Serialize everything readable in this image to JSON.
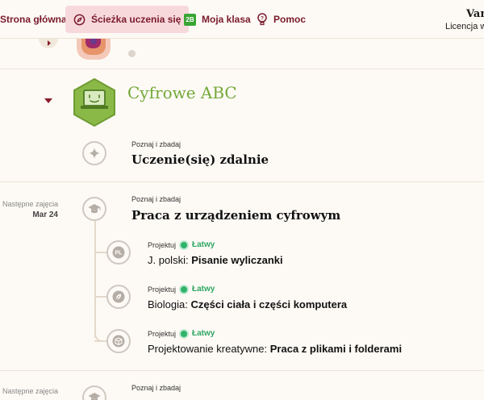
{
  "nav": {
    "items": [
      {
        "label": "Strona główna",
        "icon": "home-icon",
        "active": false
      },
      {
        "label": "Ścieżka uczenia się",
        "icon": "compass-icon",
        "active": true
      },
      {
        "label": "Moja klasa",
        "icon": "2b-badge-icon",
        "badge": "2B",
        "active": false
      },
      {
        "label": "Pomoc",
        "icon": "lightbulb-icon",
        "active": false
      }
    ],
    "user_name": "Van",
    "license": "Licencja w"
  },
  "section": {
    "title": "Cyfrowe ABC",
    "accent_color": "#74a83a"
  },
  "lessons": [
    {
      "kicker": "Poznaj i zbadaj",
      "title": "Uczenie(się) zdalnie",
      "icon": "sparkle-icon"
    },
    {
      "next_label": "Następne zajęcia",
      "next_date": "Mar 24",
      "kicker": "Poznaj i zbadaj",
      "title": "Praca z urządzeniem cyfrowym",
      "icon": "graduation-cap-icon",
      "projects": [
        {
          "kicker": "Projektuj",
          "level": "Łatwy",
          "subject": "J. polski:",
          "name": "Pisanie wyliczanki",
          "icon": "pl-icon",
          "icon_text": "PL"
        },
        {
          "kicker": "Projektuj",
          "level": "Łatwy",
          "subject": "Biologia:",
          "name": "Części ciała i części komputera",
          "icon": "leaf-icon"
        },
        {
          "kicker": "Projektuj",
          "level": "Łatwy",
          "subject": "Projektowanie kreatywne:",
          "name": "Praca z plikami i folderami",
          "icon": "box-icon"
        }
      ]
    },
    {
      "next_label": "Następne zajęcia",
      "kicker": "Poznaj i zbadaj",
      "icon": "graduation-cap-icon"
    }
  ]
}
